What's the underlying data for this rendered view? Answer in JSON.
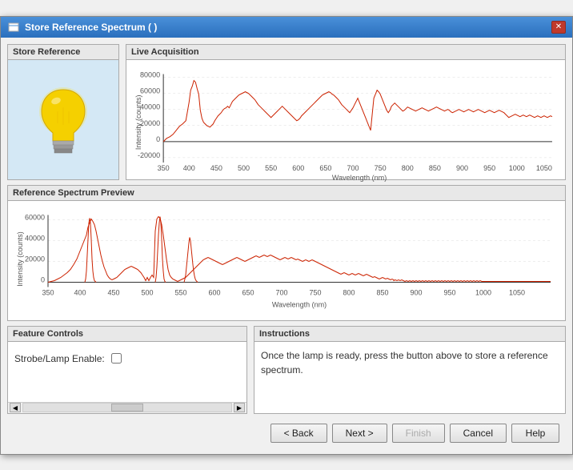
{
  "window": {
    "title": "Store Reference Spectrum ( )",
    "icon": "spectrum-icon"
  },
  "store_reference": {
    "panel_title": "Store Reference",
    "bulb_color": "#f5d000",
    "bulb_base_color": "#888"
  },
  "live_acquisition": {
    "panel_title": "Live Acquisition",
    "y_axis_label": "Intensity (counts)",
    "x_axis_label": "Wavelength (nm)",
    "y_max": "80000",
    "y_mid1": "60000",
    "y_mid2": "40000",
    "y_mid3": "20000",
    "y_zero": "0",
    "y_neg": "-20000",
    "x_ticks": [
      "350",
      "400",
      "450",
      "500",
      "550",
      "600",
      "650",
      "700",
      "750",
      "800",
      "850",
      "900",
      "950",
      "1000",
      "1050"
    ]
  },
  "reference_spectrum": {
    "panel_title": "Reference Spectrum Preview",
    "y_axis_label": "Intensity (counts)",
    "x_axis_label": "Wavelength (nm)",
    "y_max": "60000",
    "y_mid1": "40000",
    "y_mid2": "20000",
    "y_zero": "0",
    "x_ticks": [
      "350",
      "400",
      "450",
      "500",
      "550",
      "600",
      "650",
      "700",
      "750",
      "800",
      "850",
      "900",
      "950",
      "1000",
      "1050"
    ]
  },
  "feature_controls": {
    "panel_title": "Feature Controls",
    "strobe_label": "Strobe/Lamp Enable:"
  },
  "instructions": {
    "panel_title": "Instructions",
    "text": "Once the lamp is ready, press the button above to store a reference spectrum."
  },
  "buttons": {
    "back_label": "< Back",
    "next_label": "Next >",
    "finish_label": "Finish",
    "cancel_label": "Cancel",
    "help_label": "Help"
  }
}
